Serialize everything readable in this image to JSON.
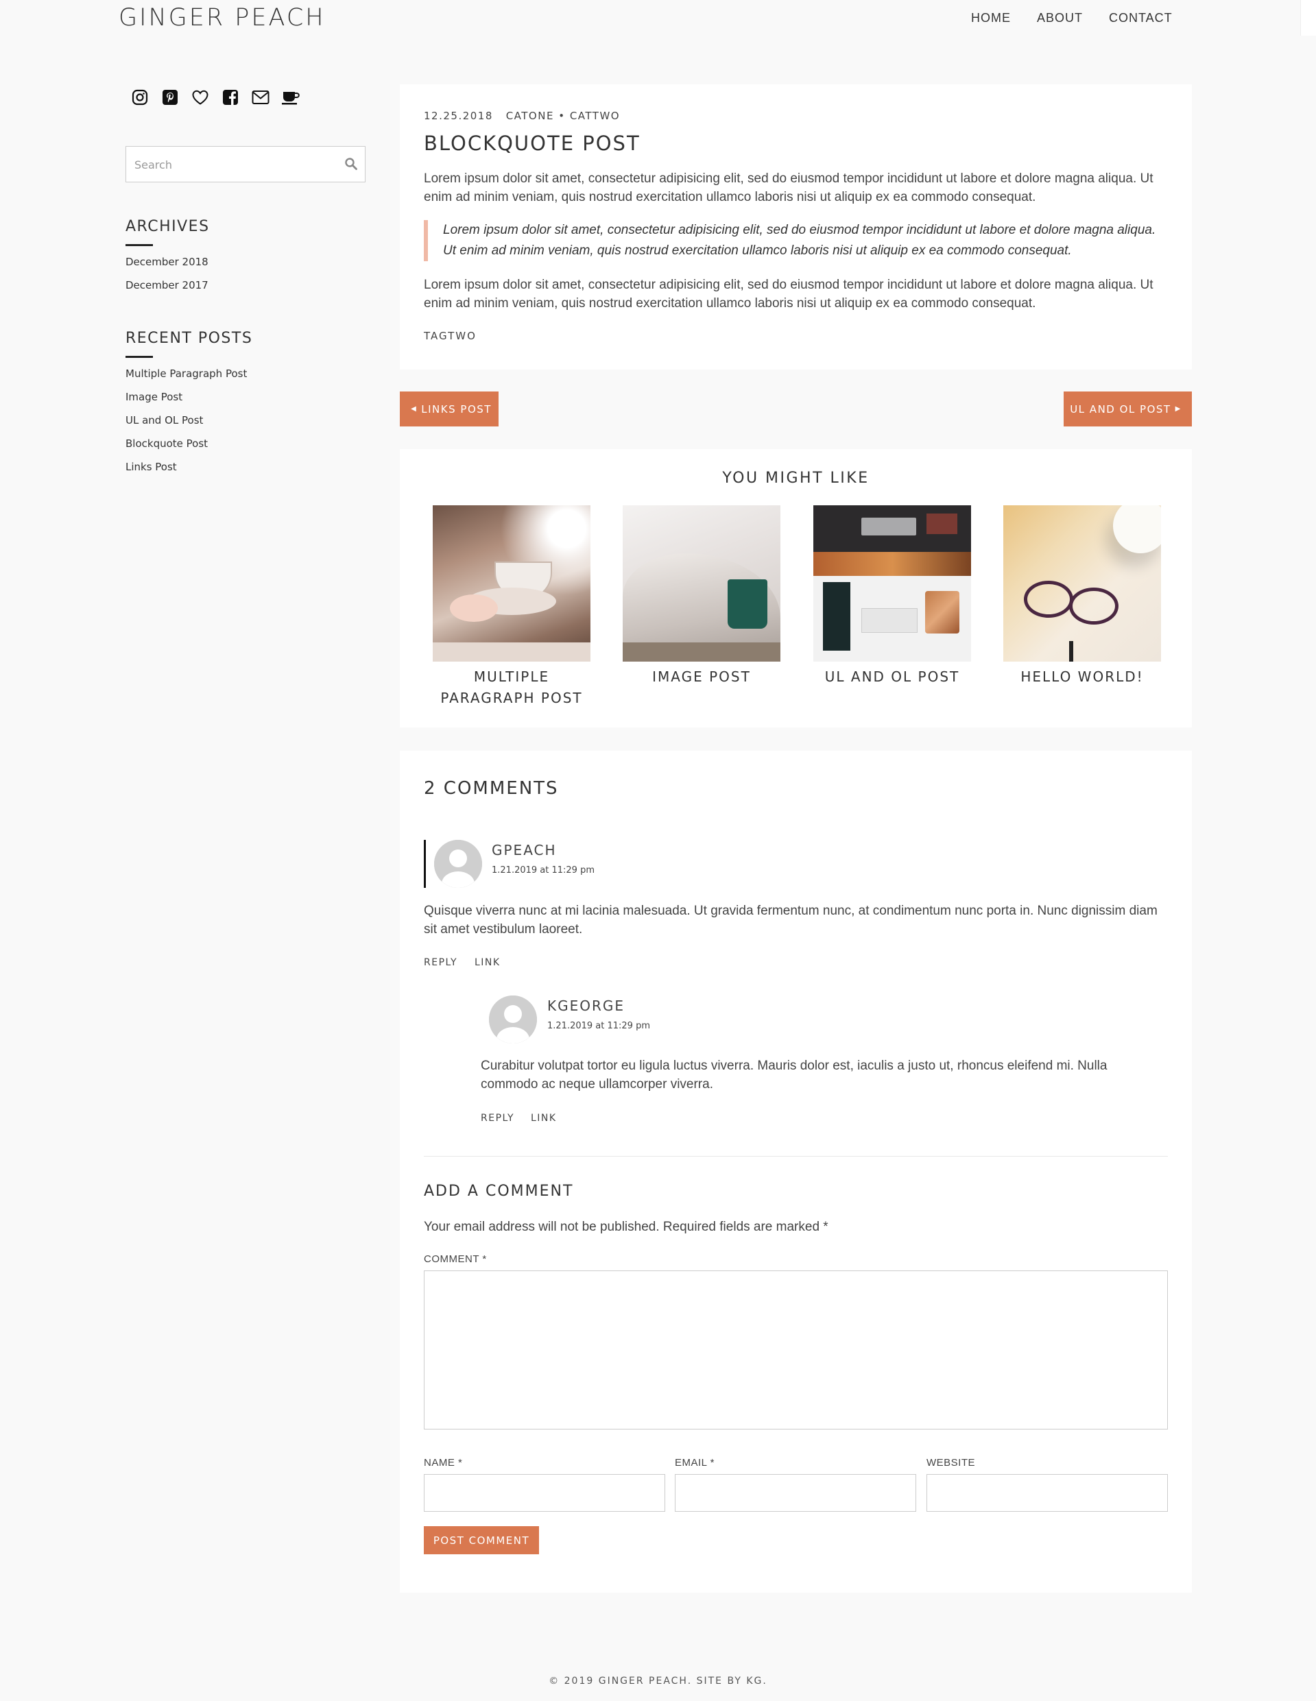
{
  "site": {
    "title": "GINGER PEACH"
  },
  "nav": {
    "home": "HOME",
    "about": "ABOUT",
    "contact": "CONTACT"
  },
  "sidebar": {
    "social_icons": [
      "instagram-icon",
      "pinterest-icon",
      "heart-icon",
      "facebook-icon",
      "mail-icon",
      "coffee-icon"
    ],
    "search_placeholder": "Search",
    "archives_title": "ARCHIVES",
    "archives": [
      "December 2018",
      "December 2017"
    ],
    "recent_title": "RECENT POSTS",
    "recent": [
      "Multiple Paragraph Post",
      "Image Post",
      "UL and OL Post",
      "Blockquote Post",
      "Links Post"
    ]
  },
  "post": {
    "date": "12.25.2018",
    "categories": "CATONE • CATTWO",
    "title": "BLOCKQUOTE POST",
    "para1": "Lorem ipsum dolor sit amet, consectetur adipisicing elit, sed do eiusmod tempor incididunt ut labore et dolore magna aliqua. Ut enim ad minim veniam, quis nostrud exercitation ullamco laboris nisi ut aliquip ex ea commodo consequat.",
    "quote": "Lorem ipsum dolor sit amet, consectetur adipisicing elit, sed do eiusmod tempor incididunt ut labore et dolore magna aliqua. Ut enim ad minim veniam, quis nostrud exercitation ullamco laboris nisi ut aliquip ex ea commodo consequat.",
    "para2": "Lorem ipsum dolor sit amet, consectetur adipisicing elit, sed do eiusmod tempor incididunt ut labore et dolore magna aliqua. Ut enim ad minim veniam, quis nostrud exercitation ullamco laboris nisi ut aliquip ex ea commodo consequat.",
    "tag": "TAGTWO"
  },
  "pager": {
    "prev": "LINKS POST",
    "next": "UL AND OL POST"
  },
  "related": {
    "title": "YOU MIGHT LIKE",
    "items": [
      "MULTIPLE PARAGRAPH POST",
      "IMAGE POST",
      "UL AND OL POST",
      "HELLO WORLD!"
    ]
  },
  "comments": {
    "title": "2 COMMENTS",
    "list": [
      {
        "author": "GPEACH",
        "date": "1.21.2019 at 11:29 pm",
        "text": "Quisque viverra nunc at mi lacinia malesuada. Ut gravida fermentum nunc, at condimentum nunc porta in. Nunc dignissim diam sit amet vestibulum laoreet.",
        "reply": "REPLY",
        "link": "LINK"
      },
      {
        "author": "KGEORGE",
        "date": "1.21.2019 at 11:29 pm",
        "text": "Curabitur volutpat tortor eu ligula luctus viverra. Mauris dolor est, iaculis a justo ut, rhoncus eleifend mi. Nulla commodo ac neque ullamcorper viverra.",
        "reply": "REPLY",
        "link": "LINK"
      }
    ]
  },
  "form": {
    "title": "ADD A COMMENT",
    "note": "Your email address will not be published. Required fields are marked *",
    "comment_label": "COMMENT *",
    "name_label": "NAME *",
    "email_label": "EMAIL *",
    "website_label": "WEBSITE",
    "submit": "POST COMMENT"
  },
  "footer": {
    "text": "© 2019 GINGER PEACH. SITE BY KG."
  },
  "colors": {
    "accent": "#d9784f",
    "quote_border": "#f0b9a6",
    "background": "#f9f9f9"
  }
}
